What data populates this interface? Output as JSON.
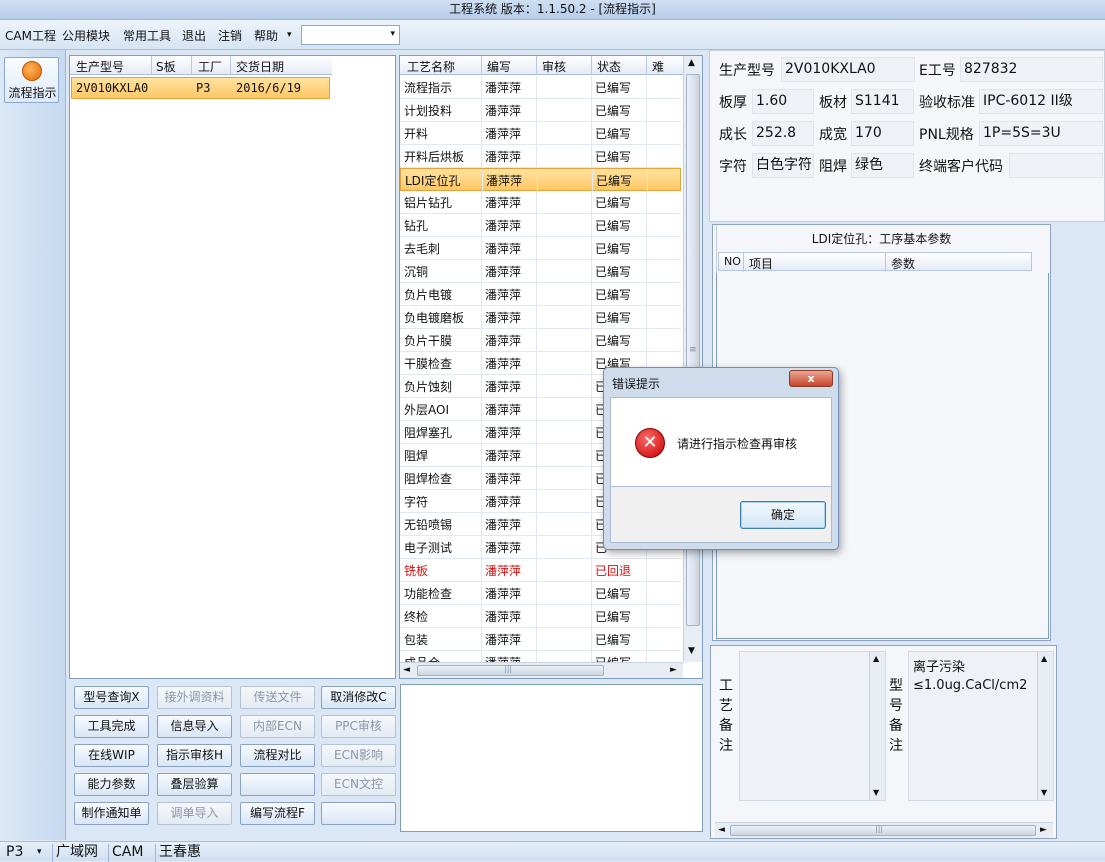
{
  "window": {
    "title": "工程系统    版本：1.1.50.2 - [流程指示]"
  },
  "menu": {
    "items": [
      "CAM工程",
      "公用模块",
      "常用工具",
      "退出",
      "注销",
      "帮助"
    ],
    "help_arrow": "▾",
    "combo_value": "",
    "combo_arrow": "▾"
  },
  "nav": {
    "button_label": "流程指示"
  },
  "order_table": {
    "headers": [
      "生产型号",
      "S板",
      "工厂",
      "交货日期"
    ],
    "rows": [
      {
        "model": "2V010KXLA0",
        "s": "",
        "factory": "P3",
        "date": "2016/6/19"
      }
    ]
  },
  "process_table": {
    "headers": [
      "工艺名称",
      "编写",
      "审核",
      "状态",
      "难"
    ],
    "rows": [
      {
        "name": "流程指示",
        "writer": "潘萍萍",
        "review": "",
        "status": "已编写"
      },
      {
        "name": "计划投料",
        "writer": "潘萍萍",
        "review": "",
        "status": "已编写"
      },
      {
        "name": "开料",
        "writer": "潘萍萍",
        "review": "",
        "status": "已编写"
      },
      {
        "name": "开料后烘板",
        "writer": "潘萍萍",
        "review": "",
        "status": "已编写"
      },
      {
        "name": "LDI定位孔",
        "writer": "潘萍萍",
        "review": "",
        "status": "已编写"
      },
      {
        "name": "铝片钻孔",
        "writer": "潘萍萍",
        "review": "",
        "status": "已编写"
      },
      {
        "name": "钻孔",
        "writer": "潘萍萍",
        "review": "",
        "status": "已编写"
      },
      {
        "name": "去毛刺",
        "writer": "潘萍萍",
        "review": "",
        "status": "已编写"
      },
      {
        "name": "沉铜",
        "writer": "潘萍萍",
        "review": "",
        "status": "已编写"
      },
      {
        "name": "负片电镀",
        "writer": "潘萍萍",
        "review": "",
        "status": "已编写"
      },
      {
        "name": "负电镀磨板",
        "writer": "潘萍萍",
        "review": "",
        "status": "已编写"
      },
      {
        "name": "负片干膜",
        "writer": "潘萍萍",
        "review": "",
        "status": "已编写"
      },
      {
        "name": "干膜检查",
        "writer": "潘萍萍",
        "review": "",
        "status": "已编写"
      },
      {
        "name": "负片蚀刻",
        "writer": "潘萍萍",
        "review": "",
        "status": "已"
      },
      {
        "name": "外层AOI",
        "writer": "潘萍萍",
        "review": "",
        "status": "已"
      },
      {
        "name": "阻焊塞孔",
        "writer": "潘萍萍",
        "review": "",
        "status": "已"
      },
      {
        "name": "阻焊",
        "writer": "潘萍萍",
        "review": "",
        "status": "已"
      },
      {
        "name": "阻焊检查",
        "writer": "潘萍萍",
        "review": "",
        "status": "已"
      },
      {
        "name": "字符",
        "writer": "潘萍萍",
        "review": "",
        "status": "已"
      },
      {
        "name": "无铅喷锡",
        "writer": "潘萍萍",
        "review": "",
        "status": "已"
      },
      {
        "name": "电子测试",
        "writer": "潘萍萍",
        "review": "",
        "status": "已"
      },
      {
        "name": "铣板",
        "writer": "潘萍萍",
        "review": "",
        "status": "已回退"
      },
      {
        "name": "功能检查",
        "writer": "潘萍萍",
        "review": "",
        "status": "已编写"
      },
      {
        "name": "终检",
        "writer": "潘萍萍",
        "review": "",
        "status": "已编写"
      },
      {
        "name": "包装",
        "writer": "潘萍萍",
        "review": "",
        "status": "已编写"
      },
      {
        "name": "成品仓",
        "writer": "潘萍萍",
        "review": "",
        "status": "已编写"
      }
    ],
    "scroll_up": "▲",
    "scroll_down": "▼",
    "scroll_left": "◄",
    "scroll_right": "►",
    "thumb_mark": "≡",
    "hthumb_mark": "|||"
  },
  "buttons": [
    [
      "型号查询X",
      "接外调资料",
      "传送文件",
      "取消修改C"
    ],
    [
      "工具完成",
      "信息导入",
      "内部ECN",
      "PPC审核"
    ],
    [
      "在线WIP",
      "指示审核H",
      "流程对比",
      "ECN影响"
    ],
    [
      "能力参数",
      "叠层验算",
      "",
      "ECN文控"
    ],
    [
      "制作通知单",
      "调单导入",
      "编写流程F",
      ""
    ]
  ],
  "info": {
    "model_label": "生产型号",
    "model": "2V010KXLA0",
    "eng_label": "E工号",
    "eng": "827832",
    "thick_label": "板厚",
    "thick": "1.60",
    "material_label": "板材",
    "material": "S1141",
    "std_label": "验收标准",
    "std": "IPC-6012 II级",
    "len_label": "成长",
    "len": "252.8",
    "wid_label": "成宽",
    "wid": "170",
    "pnl_label": "PNL规格",
    "pnl": "1P=5S=3U",
    "char_label": "字符",
    "char": "白色字符",
    "mask_label": "阻焊",
    "mask": "绿色",
    "cust_label": "终端客户代码",
    "cust": ""
  },
  "params": {
    "title": "LDI定位孔：工序基本参数",
    "headers": [
      "NO",
      "项目",
      "参数"
    ]
  },
  "remarks": {
    "process_label": [
      "工",
      "艺",
      "备",
      "注"
    ],
    "model_label": [
      "型",
      "号",
      "备",
      "注"
    ],
    "model_text_1": "离子污染",
    "model_text_2": "≤1.0ug.CaCl/cm2",
    "up": "▲",
    "down": "▼",
    "left": "◄",
    "right": "►",
    "hthumb_mark": "|||"
  },
  "dialog": {
    "title": "错误提示",
    "message": "请进行指示检查再审核",
    "ok": "确定",
    "close": "x",
    "icon_glyph": "✕"
  },
  "status": {
    "dropdown": "P3",
    "arrow": "▾",
    "tabs": [
      "广域网",
      "CAM",
      "王春惠"
    ]
  }
}
